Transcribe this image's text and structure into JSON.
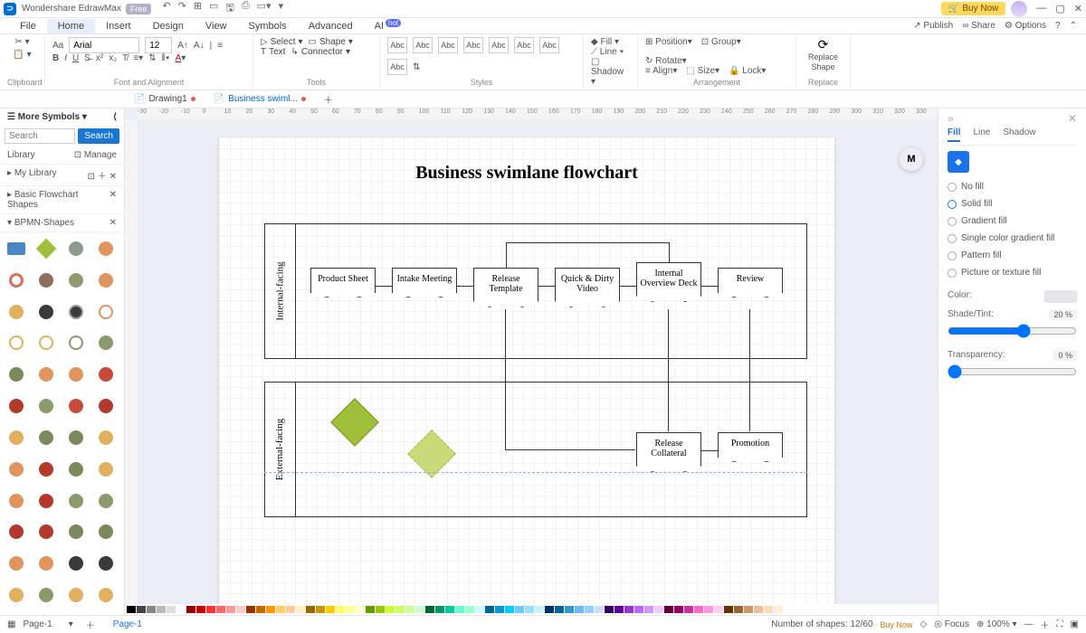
{
  "app": {
    "name": "Wondershare EdrawMax",
    "badge": "Free"
  },
  "titlebar": {
    "buynow": "Buy Now"
  },
  "menu": {
    "tabs": [
      "File",
      "Home",
      "Insert",
      "Design",
      "View",
      "Symbols",
      "Advanced",
      "AI"
    ],
    "active": 1,
    "hot": "hot",
    "right": {
      "publish": "Publish",
      "share": "Share",
      "options": "Options"
    }
  },
  "ribbon": {
    "clipboard": "Clipboard",
    "font": {
      "name": "Arial",
      "size": "12"
    },
    "fontalign": "Font and Alignment",
    "select": "Select",
    "shape": "Shape",
    "text": "Text",
    "connector": "Connector",
    "tools": "Tools",
    "abc": "Abc",
    "styles": "Styles",
    "fill": "Fill",
    "line": "Line",
    "shadow": "Shadow",
    "position": "Position",
    "group": "Group",
    "rotate": "Rotate",
    "align": "Align",
    "size_l": "Size",
    "lock": "Lock",
    "arrangement": "Arrangement",
    "replace_shape": "Replace Shape",
    "replace": "Replace"
  },
  "doctabs": {
    "t1": "Drawing1",
    "t2": "Business swiml..."
  },
  "left": {
    "header": "More Symbols",
    "search_ph": "Search",
    "search_btn": "Search",
    "library": "Library",
    "manage": "Manage",
    "mylib": "My Library",
    "basic": "Basic Flowchart Shapes",
    "bpmn": "BPMN-Shapes"
  },
  "right": {
    "tabs": {
      "fill": "Fill",
      "line": "Line",
      "shadow": "Shadow"
    },
    "nofill": "No fill",
    "solid": "Solid fill",
    "gradient": "Gradient fill",
    "single": "Single color gradient fill",
    "pattern": "Pattern fill",
    "picture": "Picture or texture fill",
    "color": "Color:",
    "shade": "Shade/Tint:",
    "shade_val": "20 %",
    "transp": "Transparency:",
    "transp_val": "0 %"
  },
  "chart_data": {
    "type": "table",
    "title": "Business swimlane flowchart",
    "lanes": [
      {
        "name": "Internal-facing",
        "nodes": [
          "Product Sheet",
          "Intake Meeting",
          "Release Template",
          "Quick & Dirty Video",
          "Internal Overview Deck",
          "Review"
        ]
      },
      {
        "name": "External-facing",
        "nodes": [
          "Release Collateral",
          "Promotion"
        ]
      }
    ]
  },
  "status": {
    "page": "Page-1",
    "page2": "Page-1",
    "shapes": "Number of shapes: 12/60",
    "buynow": "Buy Now",
    "focus": "Focus",
    "zoom": "100%"
  },
  "ruler": [
    "-30",
    "-20",
    "-10",
    "0",
    "10",
    "20",
    "30",
    "40",
    "50",
    "60",
    "70",
    "80",
    "90",
    "100",
    "110",
    "120",
    "130",
    "140",
    "150",
    "160",
    "170",
    "180",
    "190",
    "200",
    "210",
    "220",
    "230",
    "240",
    "250",
    "260",
    "270",
    "280",
    "290",
    "300",
    "310",
    "320",
    "330"
  ]
}
